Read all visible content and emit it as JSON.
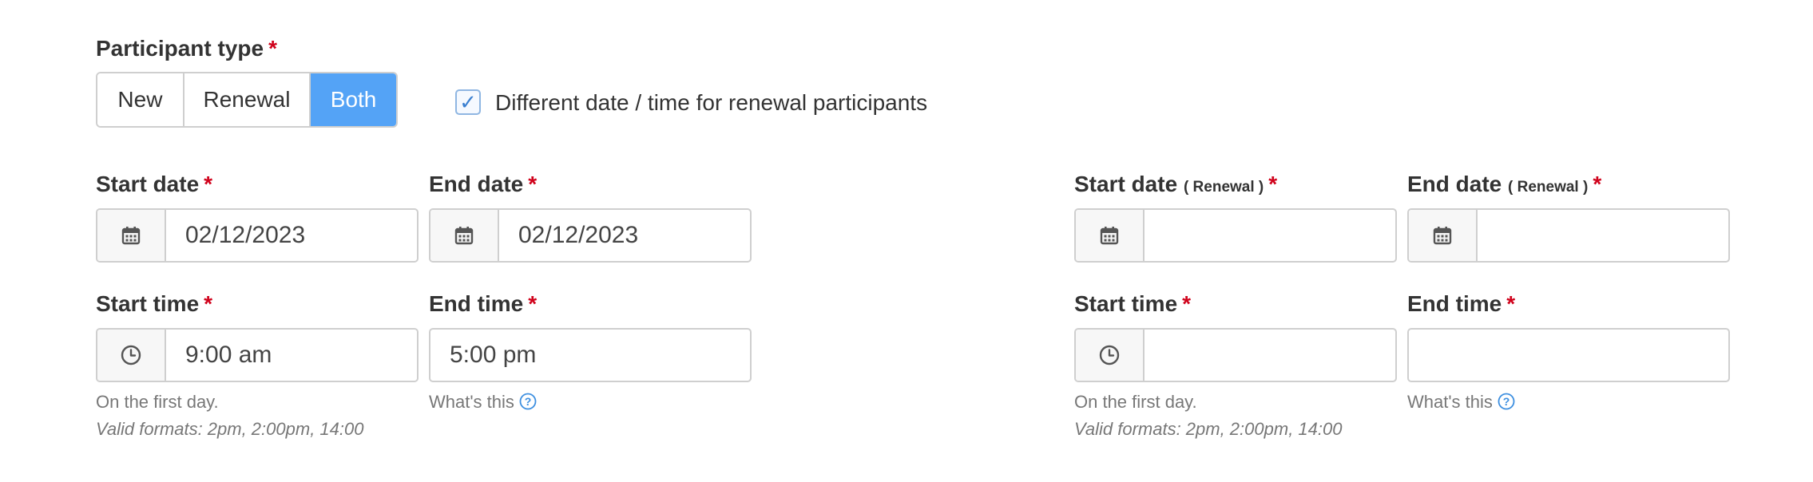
{
  "participant_type": {
    "label": "Participant type",
    "required_mark": "*",
    "options": [
      {
        "label": "New",
        "active": false
      },
      {
        "label": "Renewal",
        "active": false
      },
      {
        "label": "Both",
        "active": true
      }
    ]
  },
  "different_renewal": {
    "checked": true,
    "label": "Different date / time for renewal participants"
  },
  "standard": {
    "start_date": {
      "label": "Start date",
      "required_mark": "*",
      "value": "02/12/2023",
      "icon": "calendar-icon"
    },
    "end_date": {
      "label": "End date",
      "required_mark": "*",
      "value": "02/12/2023",
      "icon": "calendar-icon"
    },
    "start_time": {
      "label": "Start time",
      "required_mark": "*",
      "value": "9:00 am",
      "icon": "clock-icon",
      "help": "On the first day.",
      "formats": "Valid formats: 2pm, 2:00pm, 14:00"
    },
    "end_time": {
      "label": "End time",
      "required_mark": "*",
      "value": "5:00 pm",
      "help": "What's this"
    }
  },
  "renewal": {
    "start_date": {
      "label": "Start date",
      "suffix": "( Renewal )",
      "required_mark": "*",
      "value": "",
      "icon": "calendar-icon"
    },
    "end_date": {
      "label": "End date",
      "suffix": "( Renewal )",
      "required_mark": "*",
      "value": "",
      "icon": "calendar-icon"
    },
    "start_time": {
      "label": "Start time",
      "required_mark": "*",
      "value": "",
      "icon": "clock-icon",
      "help": "On the first day.",
      "formats": "Valid formats: 2pm, 2:00pm, 14:00"
    },
    "end_time": {
      "label": "End time",
      "required_mark": "*",
      "value": "",
      "help": "What's this"
    }
  },
  "colors": {
    "accent": "#54a3f6",
    "required": "#d0021b",
    "border": "#cfcfcf",
    "help_text": "#777777"
  }
}
